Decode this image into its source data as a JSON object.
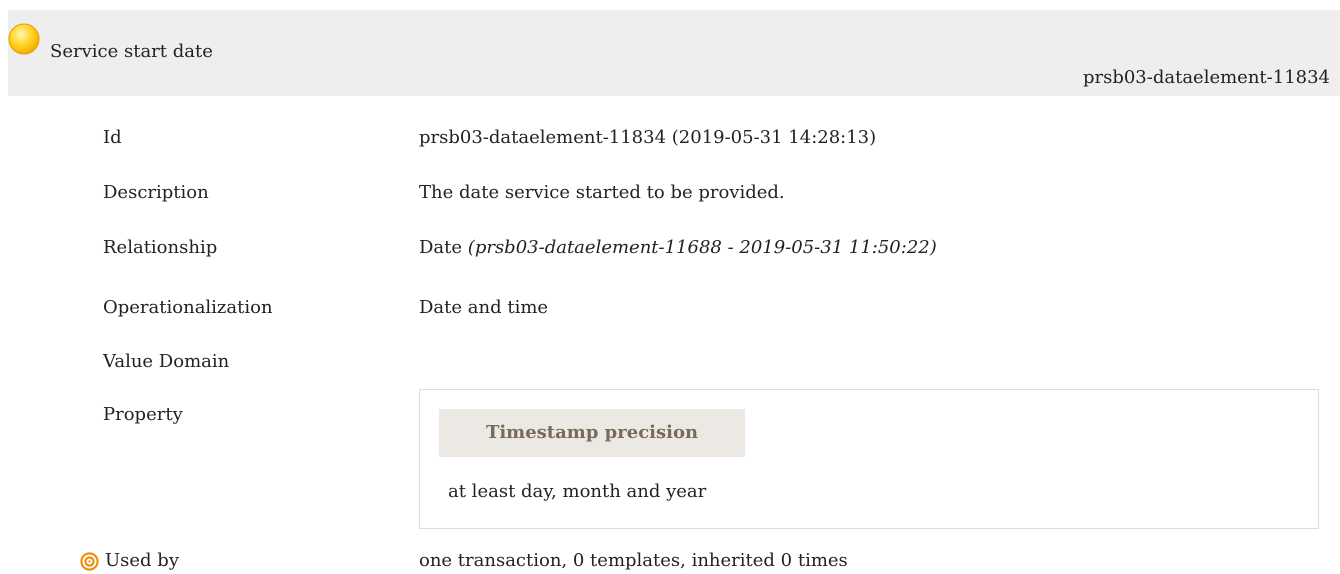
{
  "header": {
    "title": "Service start date",
    "id": "prsb03-dataelement-11834",
    "status_icon": "yellow-circle-icon",
    "status_color": "#f5b800"
  },
  "fields": {
    "id_label": "Id",
    "id_value": "prsb03-dataelement-11834 (2019-05-31 14:28:13)",
    "description_label": "Description",
    "description_value": "The date service started to be provided.",
    "relationship_label": "Relationship",
    "relationship_value": "Date",
    "relationship_detail": "(prsb03-dataelement-11688 - 2019-05-31 11:50:22)",
    "operationalization_label": "Operationalization",
    "operationalization_value": "Date and time",
    "value_domain_label": "Value Domain",
    "property_label": "Property",
    "used_by_label": "Used by",
    "used_by_icon": "target-icon",
    "used_by_value": "one transaction, 0 templates, inherited 0 times"
  },
  "property": {
    "heading": "Timestamp precision",
    "value": "at least day, month and year"
  }
}
